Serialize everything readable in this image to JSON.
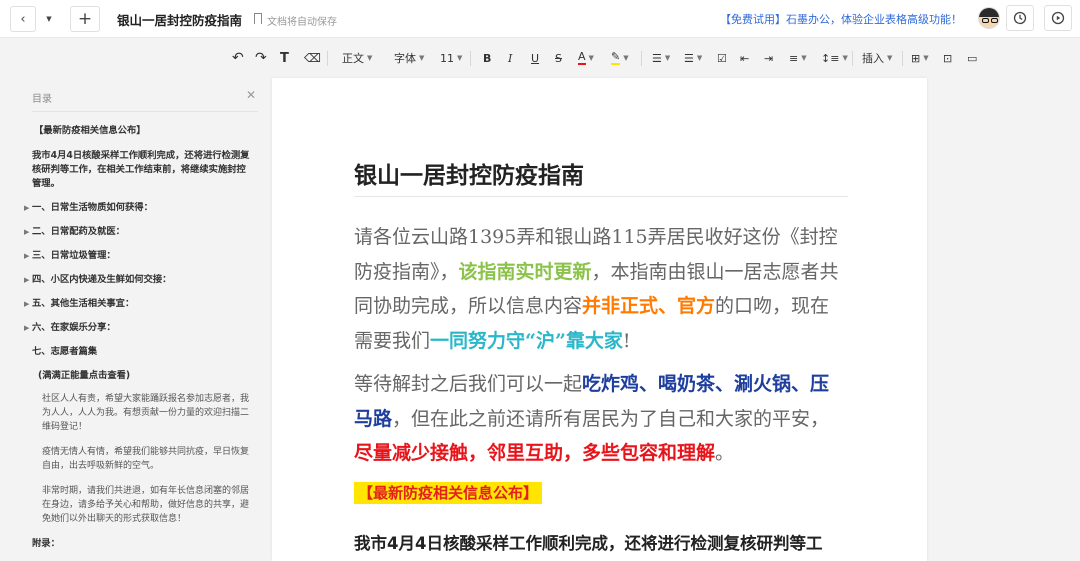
{
  "topbar": {
    "title": "银山一居封控防疫指南",
    "autosave": "文档将自动保存",
    "promo": "【免费试用】石墨办公，体验企业表格高级功能！"
  },
  "toolbar": {
    "style": "正文",
    "font": "字体",
    "size": "11",
    "insert": "插入"
  },
  "sidebar": {
    "title": "目录",
    "items": [
      "【最新防疫相关信息公布】",
      "我市4月4日核酸采样工作顺利完成，还将进行检测复核研判等工作，在相关工作结束前，将继续实施封控管理。",
      "一、日常生活物质如何获得：",
      "二、日常配药及就医：",
      "三、日常垃圾管理：",
      "四、小区内快递及生鲜如何交接：",
      "五、其他生活相关事宜：",
      "六、在家娱乐分享：",
      "七、志愿者篇集",
      "(满满正能量点击查看)",
      "社区人人有责，希望大家能踊跃报名参加志愿者，我为人人，人人为我。有想贡献一份力量的欢迎扫描二维码登记！",
      "疫情无情人有情，希望我们能够共同抗疫，早日恢复自由，出去呼吸新鲜的空气。",
      "非常时期，请我们共进退，如有年长信息闭塞的邻居在身边，请多给予关心和帮助，做好信息的共享，避免她们以外出聊天的形式获取信息！",
      "附录："
    ]
  },
  "document": {
    "heading": "银山一居封控防疫指南",
    "p1": {
      "t1": "请各位云山路1395弄和银山路115弄居民收好这份《封控防疫指南》，",
      "g": "该指南实时更新",
      "t2": "，本指南由银山一居志愿者共同协助完成，所以信息内容",
      "o": "并非正式、官方",
      "t3": "的口吻，现在需要我们",
      "c": "一同努力守“沪”靠大家",
      "t4": "!"
    },
    "p2": {
      "t1": "等待解封之后我们可以一起",
      "b": "吃炸鸡、喝奶茶、涮火锅、压马路",
      "t2": "，但在此之前还请所有居民为了自己和大家的平安，",
      "r": "尽量减少接触，邻里互助，多些包容和理解",
      "t3": "。"
    },
    "highlight": "【最新防疫相关信息公布】",
    "bodybold": "我市4月4日核酸采样工作顺利完成，还将进行检测复核研判等工"
  }
}
